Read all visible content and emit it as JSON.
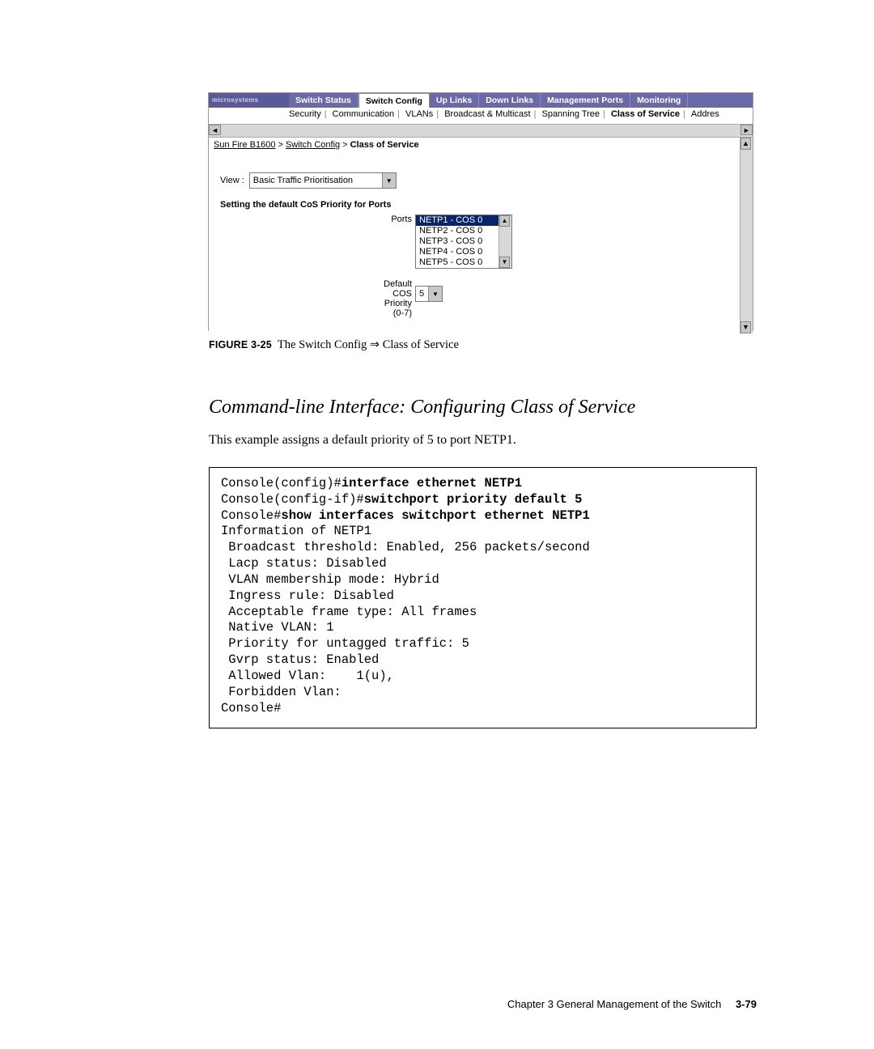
{
  "screenshot": {
    "brand": "microsystems",
    "tabs": [
      "Switch Status",
      "Switch Config",
      "Up Links",
      "Down Links",
      "Management Ports",
      "Monitoring"
    ],
    "active_tab": "Switch Config",
    "subnav": [
      "Security",
      "Communication",
      "VLANs",
      "Broadcast & Multicast",
      "Spanning Tree",
      "Class of Service",
      "Addres"
    ],
    "subnav_active": "Class of Service",
    "breadcrumb": {
      "root": "Sun Fire B1600",
      "mid": "Switch Config",
      "leaf": "Class of Service"
    },
    "view_label": "View :",
    "view_value": "Basic Traffic Prioritisation",
    "section_heading": "Setting the default CoS Priority for Ports",
    "ports_label": "Ports",
    "ports_list": [
      "NETP1 - COS 0",
      "NETP2 - COS 0",
      "NETP3 - COS 0",
      "NETP4 - COS 0",
      "NETP5 - COS 0"
    ],
    "ports_selected": "NETP1 - COS 0",
    "default_cos_label": "Default\nCOS\nPriority\n(0-7)",
    "default_cos_value": "5"
  },
  "caption": {
    "prefix": "FIGURE 3-25",
    "text_a": "The Switch Config ",
    "text_b": " Class of Service"
  },
  "heading": "Command-line Interface: Configuring Class of Service",
  "para": "This example assigns a default priority of 5 to port NETP1.",
  "cli": {
    "l1a": "Console(config)#",
    "l1b": "interface ethernet NETP1",
    "l2a": "Console(config-if)#",
    "l2b": "switchport priority default 5",
    "l3a": "Console#",
    "l3b": "show interfaces switchport ethernet NETP1",
    "l4": "Information of NETP1",
    "l5": " Broadcast threshold: Enabled, 256 packets/second",
    "l6": " Lacp status: Disabled",
    "l7": " VLAN membership mode: Hybrid",
    "l8": " Ingress rule: Disabled",
    "l9": " Acceptable frame type: All frames",
    "l10": " Native VLAN: 1",
    "l11": " Priority for untagged traffic: 5",
    "l12": " Gvrp status: Enabled",
    "l13": " Allowed Vlan:    1(u),",
    "l14": " Forbidden Vlan:",
    "l15": "Console#"
  },
  "footer": {
    "chapter": "Chapter 3   General Management of the Switch",
    "page": "3-79"
  }
}
